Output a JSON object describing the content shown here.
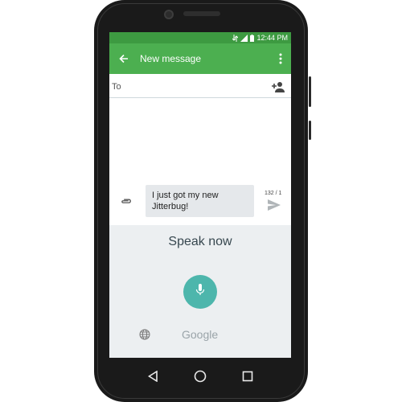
{
  "status_bar": {
    "time": "12:44 PM",
    "icons": [
      "data-icon",
      "signal-icon",
      "battery-icon"
    ]
  },
  "app_bar": {
    "title": "New message",
    "back_icon": "arrow-left-icon",
    "menu_icon": "more-vert-icon"
  },
  "recipient": {
    "label": "To",
    "add_icon": "person-add-icon"
  },
  "compose": {
    "message_text": "I just got my new Jitterbug!",
    "char_counter": "132 / 1",
    "attach_icon": "paperclip-icon",
    "send_icon": "send-icon"
  },
  "voice_input": {
    "prompt": "Speak now",
    "brand": "Google",
    "mic_icon": "microphone-icon",
    "language_icon": "globe-icon"
  },
  "nav_bar": {
    "buttons": [
      "back-triangle-icon",
      "home-circle-icon",
      "recents-square-icon"
    ]
  },
  "colors": {
    "app_bar": "#4caf50",
    "status_bar": "#3d9a41",
    "mic_button": "#4db6ac",
    "voice_panel": "#eceff1"
  }
}
